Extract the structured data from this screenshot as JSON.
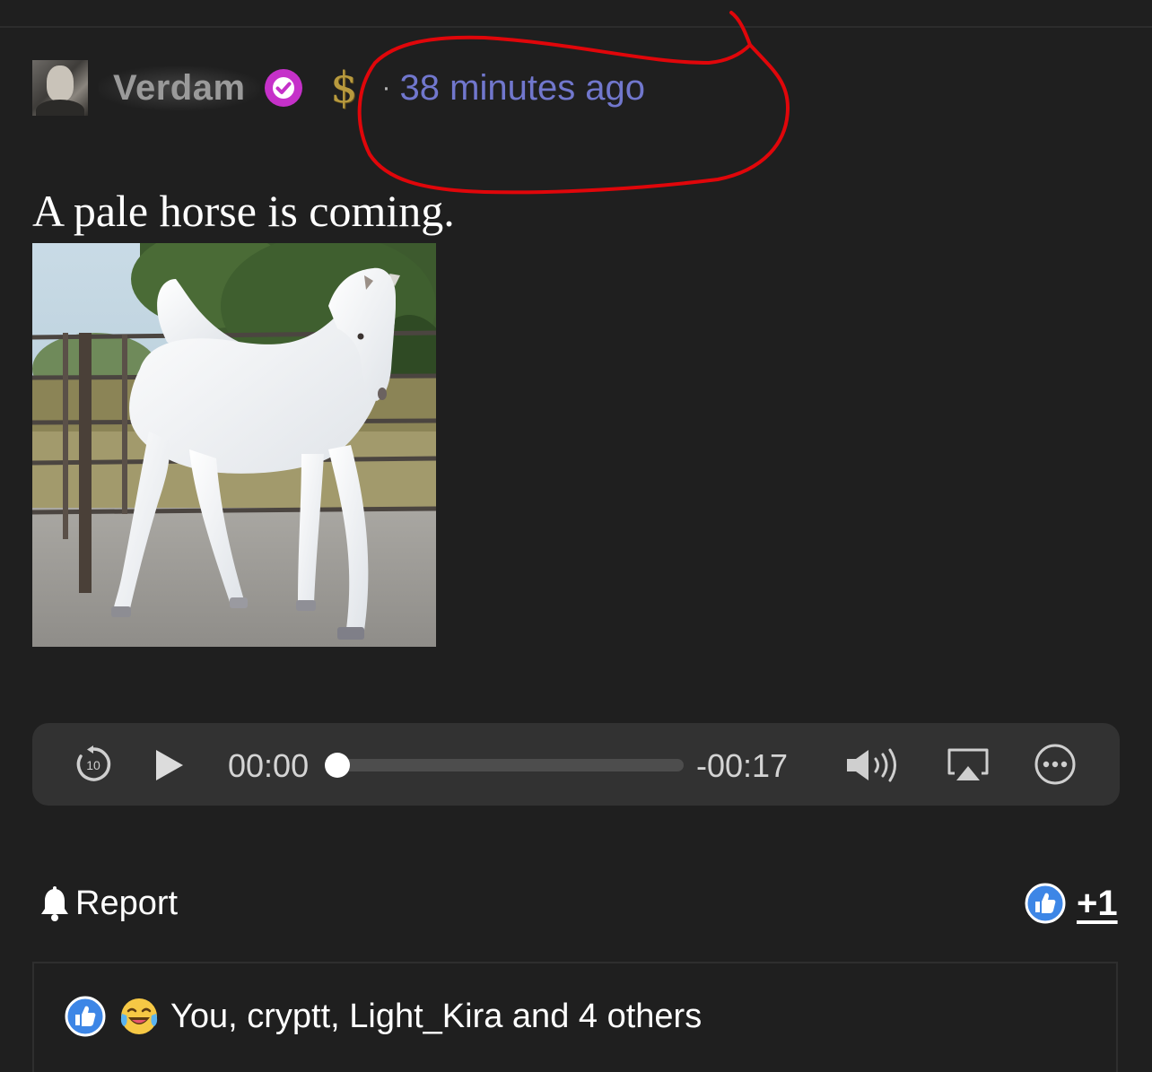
{
  "post": {
    "author": "Verdam",
    "timestamp": "38 minutes ago",
    "separator": "·",
    "dollar_symbol": "$",
    "text": "A pale horse is coming.",
    "icons": [
      "verified-badge-icon",
      "dollar-icon"
    ]
  },
  "audio": {
    "current_time": "00:00",
    "remaining_time": "-00:17",
    "progress": 0,
    "rewind_seconds": "10",
    "icons": [
      "rewind-10-icon",
      "play-icon",
      "volume-icon",
      "airplay-icon",
      "more-options-icon"
    ]
  },
  "actions": {
    "report_label": "Report",
    "like_count": "+1",
    "icons": [
      "bell-icon",
      "thumbs-up-icon"
    ]
  },
  "reactions": {
    "summary": "You, cryptt, Light_Kira and 4 others",
    "icons": [
      "thumbs-up-icon",
      "laughing-crying-icon"
    ]
  },
  "colors": {
    "background": "#1f1f1f",
    "timestamp": "#7177cd",
    "verified_badge": "#c531c9",
    "like_blue": "#3d86e6",
    "annotation_red": "#e0060a"
  }
}
